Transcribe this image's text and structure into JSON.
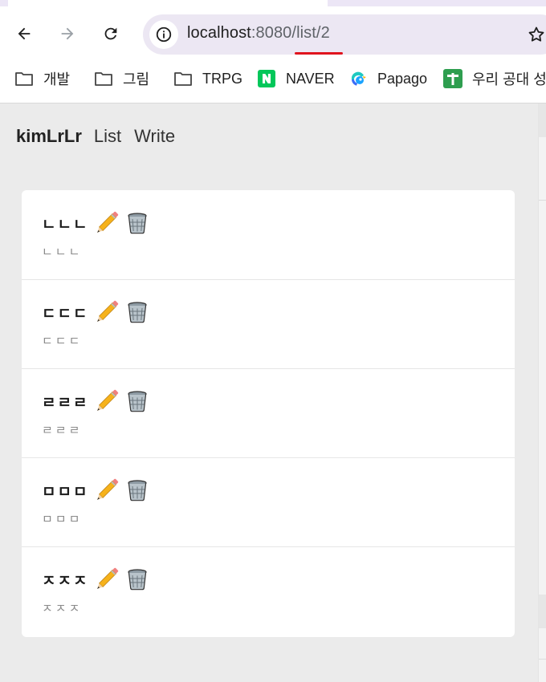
{
  "browser": {
    "url": {
      "host": "localhost",
      "port": ":8080",
      "path": "/list/2"
    },
    "bookmarks": [
      {
        "label": "개발",
        "icon": "folder-icon"
      },
      {
        "label": "그림",
        "icon": "folder-icon"
      },
      {
        "label": "TRPG",
        "icon": "folder-icon"
      },
      {
        "label": "NAVER",
        "icon": "naver-icon",
        "color": "#03c75a"
      },
      {
        "label": "Papago",
        "icon": "papago-icon"
      },
      {
        "label": "우리 공대 성",
        "icon": "green-plus-icon",
        "color": "#2e9e4f"
      }
    ]
  },
  "app": {
    "brand": "kimLrLr",
    "nav": [
      "List",
      "Write"
    ],
    "items": [
      {
        "title": "ㄴㄴㄴ",
        "content": "ㄴㄴㄴ"
      },
      {
        "title": "ㄷㄷㄷ",
        "content": "ㄷㄷㄷ"
      },
      {
        "title": "ㄹㄹㄹ",
        "content": "ㄹㄹㄹ"
      },
      {
        "title": "ㅁㅁㅁ",
        "content": "ㅁㅁㅁ"
      },
      {
        "title": "ㅈㅈㅈ",
        "content": "ㅈㅈㅈ"
      }
    ]
  },
  "colors": {
    "accent_underline": "#e0141e",
    "page_bg": "#ebebeb"
  }
}
